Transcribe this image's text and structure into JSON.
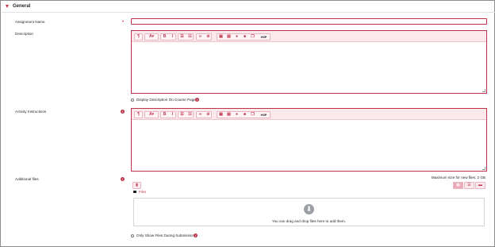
{
  "section": {
    "title": "General"
  },
  "fields": {
    "assignment_name": {
      "label": "Assignment Name",
      "value": ""
    },
    "description": {
      "label": "Description",
      "value": ""
    },
    "display_description": {
      "label": "Display Description On Course Page"
    },
    "activity_instructions": {
      "label": "Activity Instructions",
      "value": ""
    },
    "additional_files": {
      "label": "Additional files"
    },
    "only_show_files": {
      "label": "Only Show Files During Submission"
    }
  },
  "toolbar": {
    "icons": [
      "paragraph-style-icon",
      "font-color-icon",
      "bold-icon",
      "italic-icon",
      "unordered-list-icon",
      "ordered-list-icon",
      "link-icon",
      "unlink-icon",
      "image-icon",
      "media-icon",
      "record-audio-icon",
      "record-video-icon",
      "manage-files-icon",
      "h5p-icon"
    ],
    "h5p_label": "H5P"
  },
  "filepicker": {
    "max_size": "Maximum size for new files: 2 GB",
    "files_label": "Files",
    "drop_text": "You can drag and drop files here to add them."
  },
  "colors": {
    "accent": "#c0334a",
    "toolbar_bg": "#fbe9ec"
  }
}
